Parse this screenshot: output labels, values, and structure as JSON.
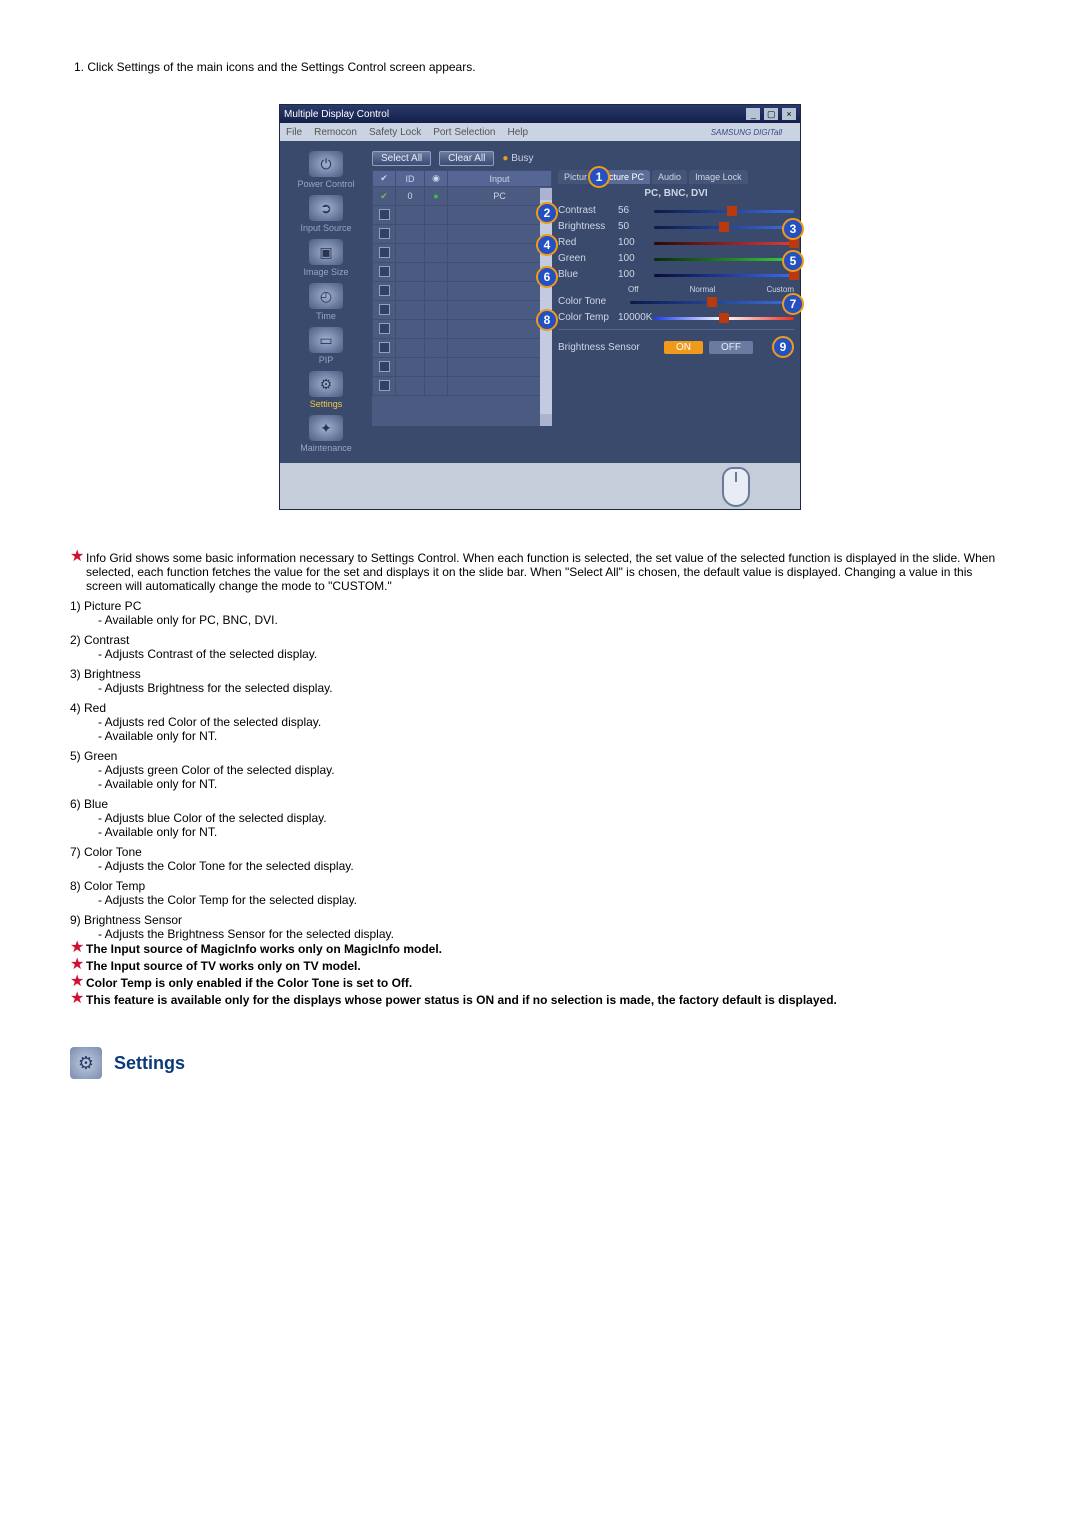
{
  "intro": "1.  Click Settings of the main icons and the Settings Control screen appears.",
  "app": {
    "title": "Multiple Display Control",
    "menubar": [
      "File",
      "Remocon",
      "Safety Lock",
      "Port Selection",
      "Help"
    ],
    "brand": "SAMSUNG DIGITall",
    "toolbar": {
      "select_all": "Select All",
      "clear_all": "Clear All",
      "busy": "Busy"
    },
    "sidebar": [
      {
        "label": "Power Control",
        "glyph": "⏻"
      },
      {
        "label": "Input Source",
        "glyph": "➲"
      },
      {
        "label": "Image Size",
        "glyph": "▣"
      },
      {
        "label": "Time",
        "glyph": "◴"
      },
      {
        "label": "PIP",
        "glyph": "▭"
      },
      {
        "label": "Settings",
        "glyph": "⚙",
        "active": true
      },
      {
        "label": "Maintenance",
        "glyph": "✦"
      }
    ],
    "grid": {
      "headers": [
        "",
        "ID",
        "",
        "Input"
      ],
      "row0": {
        "id": "0",
        "input": "PC"
      },
      "blank_rows": 10
    },
    "tabs": [
      "Pictur",
      "Picture PC",
      "Audio",
      "Image Lock"
    ],
    "active_tab": "Picture PC",
    "subhead": "PC, BNC, DVI",
    "controls": {
      "contrast": {
        "label": "Contrast",
        "value": "56",
        "pct": 56
      },
      "brightness": {
        "label": "Brightness",
        "value": "50",
        "pct": 50
      },
      "red": {
        "label": "Red",
        "value": "100",
        "pct": 100
      },
      "green": {
        "label": "Green",
        "value": "100",
        "pct": 100
      },
      "blue": {
        "label": "Blue",
        "value": "100",
        "pct": 100
      },
      "color_tone": {
        "label": "Color Tone",
        "options": [
          "Off",
          "Normal",
          "Custom"
        ],
        "pct": 50
      },
      "color_temp": {
        "label": "Color Temp",
        "value": "10000K",
        "pct": 50
      },
      "brightness_sensor": {
        "label": "Brightness Sensor",
        "on": "ON",
        "off": "OFF"
      }
    },
    "callouts": [
      "1",
      "2",
      "3",
      "4",
      "5",
      "6",
      "7",
      "8",
      "9"
    ]
  },
  "notes": {
    "star_intro": "Info Grid shows some basic information necessary to Settings Control. When each function is selected, the set value of the selected function is displayed in the slide. When selected, each function fetches the value for the set and displays it on the slide bar. When \"Select All\" is chosen, the default value is displayed. Changing a value in this screen will automatically change the mode to \"CUSTOM.\"",
    "items": [
      {
        "n": "1)",
        "title": "Picture PC",
        "subs": [
          "- Available only for PC, BNC, DVI."
        ]
      },
      {
        "n": "2)",
        "title": "Contrast",
        "subs": [
          "- Adjusts Contrast of the selected display."
        ]
      },
      {
        "n": "3)",
        "title": "Brightness",
        "subs": [
          "- Adjusts Brightness for the selected display."
        ]
      },
      {
        "n": "4)",
        "title": "Red",
        "subs": [
          "- Adjusts red Color of the selected display.",
          "- Available  only for NT."
        ]
      },
      {
        "n": "5)",
        "title": "Green",
        "subs": [
          "- Adjusts green Color of the selected display.",
          "- Available  only for NT."
        ]
      },
      {
        "n": "6)",
        "title": "Blue",
        "subs": [
          "- Adjusts blue Color of the selected display.",
          "- Available  only for NT."
        ]
      },
      {
        "n": "7)",
        "title": "Color Tone",
        "subs": [
          "- Adjusts the Color Tone for the selected display."
        ]
      },
      {
        "n": "8)",
        "title": "Color Temp",
        "subs": [
          "- Adjusts the Color Temp for the selected display."
        ]
      },
      {
        "n": "9)",
        "title": "Brightness Sensor",
        "subs": [
          "- Adjusts the Brightness Sensor for the selected display."
        ]
      }
    ],
    "footers": [
      "The Input source of MagicInfo works only on MagicInfo model.",
      "The Input source of TV works only on TV model.",
      "Color Temp is only enabled if the Color Tone is set to Off.",
      "This feature is available only for the displays whose power status is ON and if no selection is made, the factory default is displayed."
    ]
  },
  "section_heading": "Settings"
}
